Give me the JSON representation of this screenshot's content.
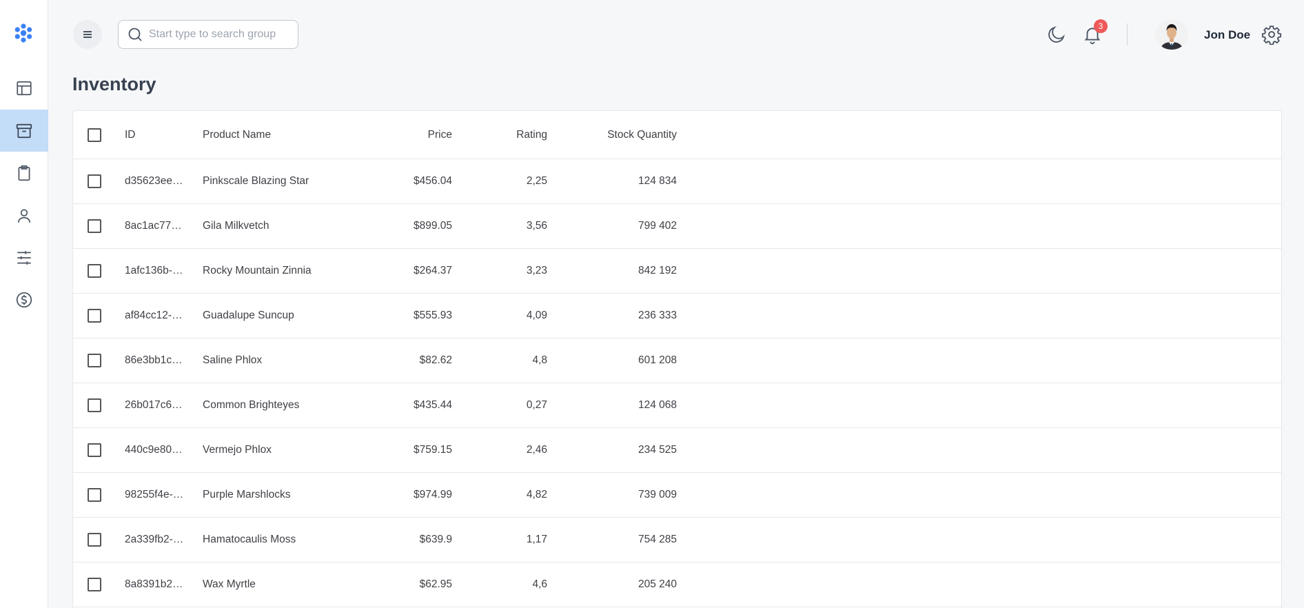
{
  "search": {
    "placeholder": "Start type to search group"
  },
  "notifications": {
    "count": "3"
  },
  "user": {
    "name": "Jon Doe"
  },
  "page": {
    "title": "Inventory"
  },
  "sidebar": {
    "items": [
      {
        "name": "dashboard-icon"
      },
      {
        "name": "archive-icon",
        "active": true
      },
      {
        "name": "clipboard-icon"
      },
      {
        "name": "user-icon"
      },
      {
        "name": "sliders-icon"
      },
      {
        "name": "dollar-icon"
      }
    ]
  },
  "table": {
    "columns": {
      "id": "ID",
      "name": "Product Name",
      "price": "Price",
      "rating": "Rating",
      "stock": "Stock Quantity"
    },
    "rows": [
      {
        "id": "d35623ee…",
        "name": "Pinkscale Blazing Star",
        "price": "$456.04",
        "rating": "2,25",
        "stock": "124 834"
      },
      {
        "id": "8ac1ac77…",
        "name": "Gila Milkvetch",
        "price": "$899.05",
        "rating": "3,56",
        "stock": "799 402"
      },
      {
        "id": "1afc136b-…",
        "name": "Rocky Mountain Zinnia",
        "price": "$264.37",
        "rating": "3,23",
        "stock": "842 192"
      },
      {
        "id": "af84cc12-…",
        "name": "Guadalupe Suncup",
        "price": "$555.93",
        "rating": "4,09",
        "stock": "236 333"
      },
      {
        "id": "86e3bb1c…",
        "name": "Saline Phlox",
        "price": "$82.62",
        "rating": "4,8",
        "stock": "601 208"
      },
      {
        "id": "26b017c6…",
        "name": "Common Brighteyes",
        "price": "$435.44",
        "rating": "0,27",
        "stock": "124 068"
      },
      {
        "id": "440c9e80…",
        "name": "Vermejo Phlox",
        "price": "$759.15",
        "rating": "2,46",
        "stock": "234 525"
      },
      {
        "id": "98255f4e-…",
        "name": "Purple Marshlocks",
        "price": "$974.99",
        "rating": "4,82",
        "stock": "739 009"
      },
      {
        "id": "2a339fb2-…",
        "name": "Hamatocaulis Moss",
        "price": "$639.9",
        "rating": "1,17",
        "stock": "754 285"
      },
      {
        "id": "8a8391b2…",
        "name": "Wax Myrtle",
        "price": "$62.95",
        "rating": "4,6",
        "stock": "205 240"
      }
    ]
  }
}
